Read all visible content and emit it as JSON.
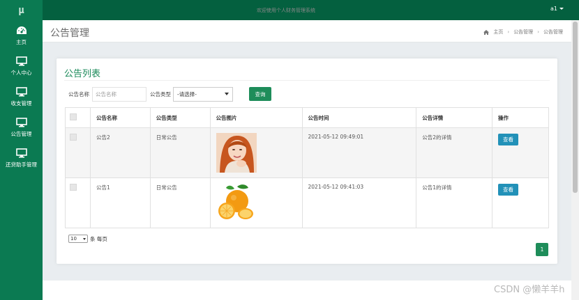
{
  "app": {
    "logo": "μ",
    "user": "a1"
  },
  "sidebar": {
    "items": [
      {
        "label": "主页",
        "icon": "dashboard-icon"
      },
      {
        "label": "个人中心",
        "icon": "monitor-icon"
      },
      {
        "label": "收支管理",
        "icon": "monitor-icon"
      },
      {
        "label": "公告管理",
        "icon": "monitor-icon"
      },
      {
        "label": "还贷助手管理",
        "icon": "monitor-icon"
      }
    ]
  },
  "header": {
    "title": "公告管理",
    "breadcrumb": [
      "主页",
      "公告管理",
      "公告管理"
    ]
  },
  "card": {
    "title": "公告列表",
    "filters": {
      "name_label": "公告名称",
      "name_placeholder": "公告名称",
      "type_label": "公告类型",
      "type_selected": "-请选择-",
      "query_button": "查询"
    },
    "table": {
      "columns": [
        "公告名称",
        "公告类型",
        "公告图片",
        "公告时间",
        "公告详情",
        "操作"
      ],
      "rows": [
        {
          "name": "公告2",
          "type": "日常公告",
          "image": "portrait-photo",
          "time": "2021-05-12 09:49:01",
          "detail": "公告2的详情",
          "action": "查看"
        },
        {
          "name": "公告1",
          "type": "日常公告",
          "image": "orange-photo",
          "time": "2021-05-12 09:41:03",
          "detail": "公告1的详情",
          "action": "查看"
        }
      ]
    },
    "pagination": {
      "page_size": "10",
      "page_size_suffix": "条 每页",
      "current_page": "1"
    }
  },
  "footer": {
    "text": "欢迎使用个人财务管理系统"
  },
  "watermark": "CSDN @懒羊羊h",
  "colors": {
    "topbar": "#04603f",
    "sidebar": "#0b7a52",
    "accent": "#1e8d5a",
    "view_button": "#2291b8",
    "title_green": "#1b8a5a"
  }
}
